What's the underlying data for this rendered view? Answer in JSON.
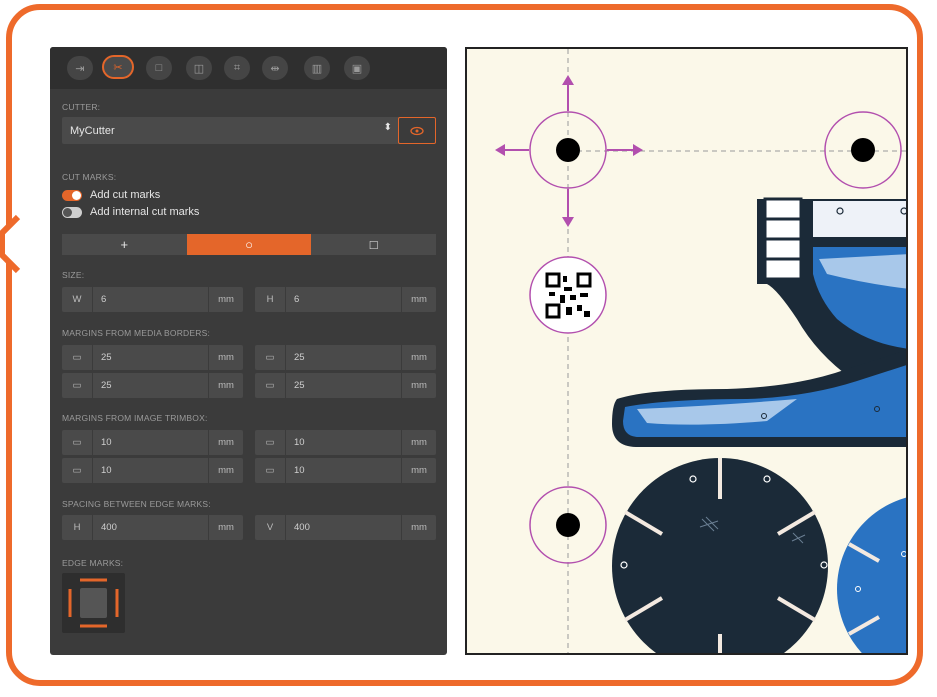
{
  "colors": {
    "accent": "#e4662a",
    "frame": "#ee6a2b",
    "panel": "#3b3b3b",
    "marks": "#b24fae",
    "canvas": "#fbf8e9"
  },
  "toolbar": {
    "icons": [
      "import-icon",
      "cut-icon",
      "square-icon",
      "target-icon",
      "frame-icon",
      "mirror-icon",
      "barcode-icon",
      "calendar-icon"
    ],
    "active_index": 1
  },
  "cutter": {
    "label": "CUTTER:",
    "value": "MyCutter"
  },
  "cut_marks": {
    "label": "CUT MARKS:",
    "add_cut_marks": "Add cut marks",
    "add_cut_marks_on": true,
    "add_internal": "Add internal cut marks",
    "add_internal_on": false,
    "shapes": [
      "+",
      "○",
      "□"
    ],
    "selected_shape": 1
  },
  "size": {
    "label": "SIZE:",
    "w_label": "W",
    "w": "6",
    "h_label": "H",
    "h": "6",
    "unit": "mm"
  },
  "margins_media": {
    "label": "MARGINS FROM MEDIA BORDERS:",
    "values": [
      "25",
      "25",
      "25",
      "25"
    ],
    "unit": "mm"
  },
  "margins_trim": {
    "label": "MARGINS FROM IMAGE TRIMBOX:",
    "values": [
      "10",
      "10",
      "10",
      "10"
    ],
    "unit": "mm"
  },
  "spacing": {
    "label": "SPACING BETWEEN EDGE MARKS:",
    "h_label": "H",
    "h": "400",
    "v_label": "V",
    "v": "400",
    "unit": "mm"
  },
  "edge_marks": {
    "label": "EDGE MARKS:"
  }
}
